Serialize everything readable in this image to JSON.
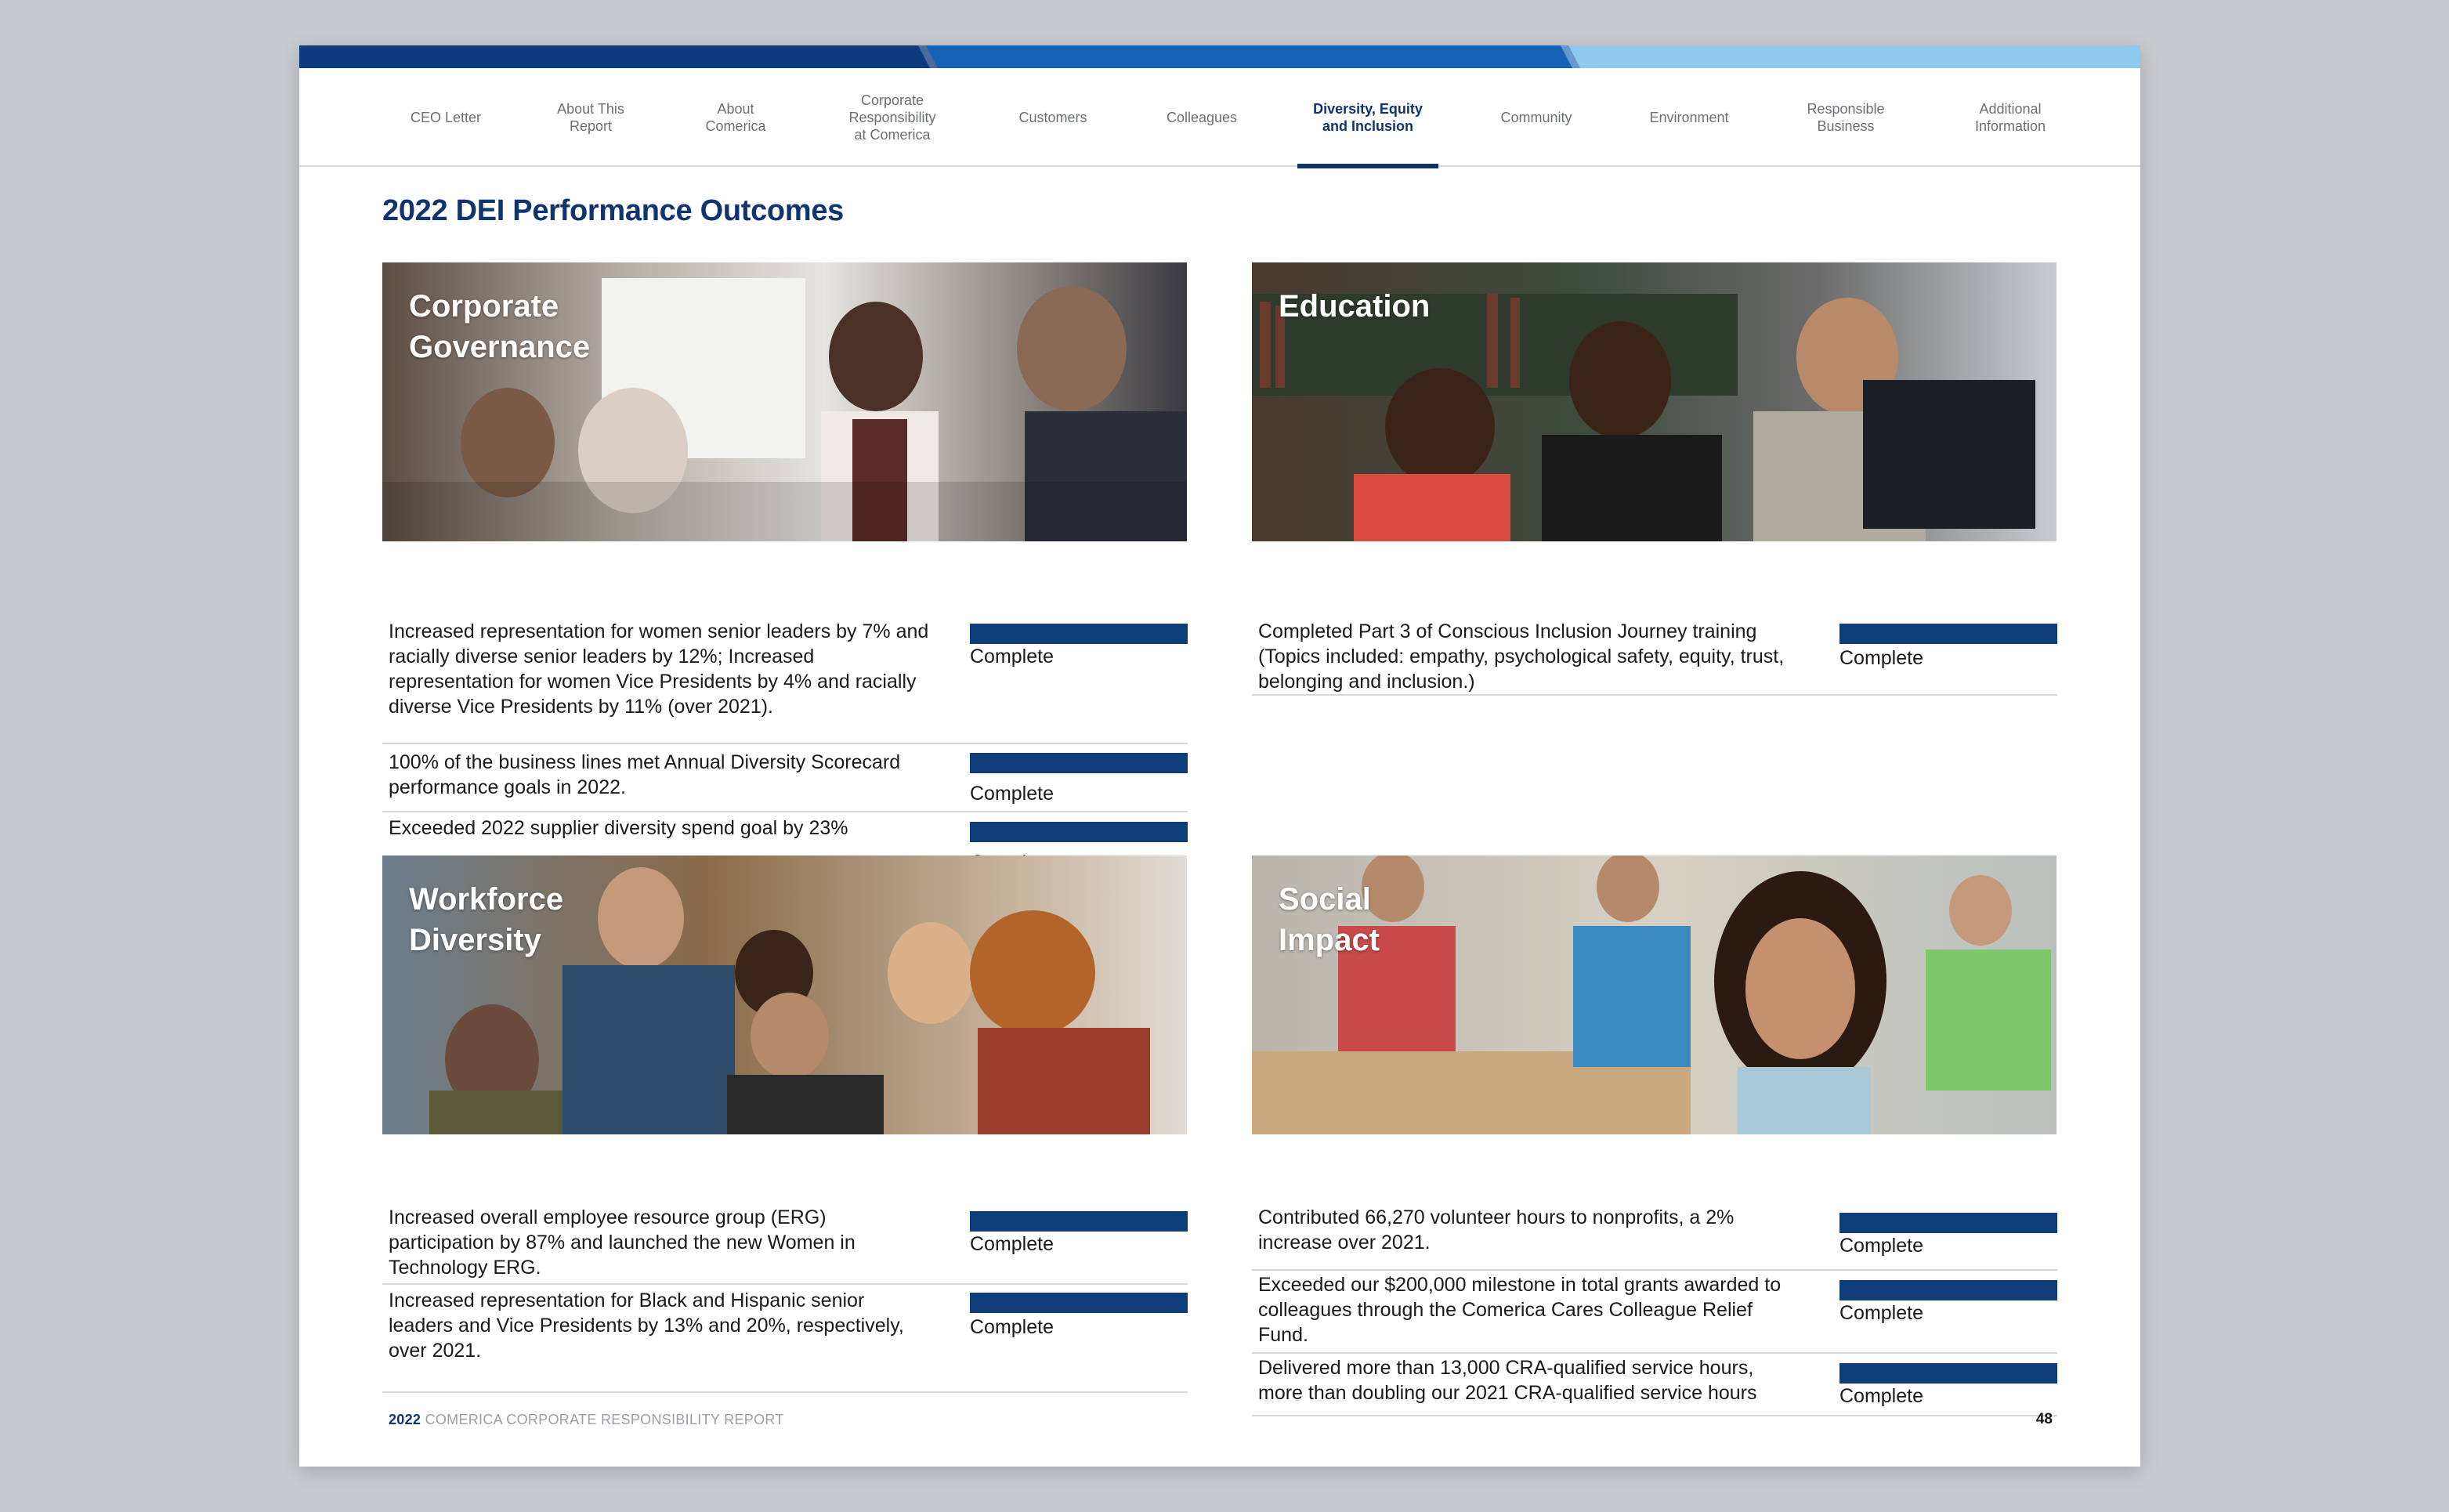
{
  "nav": {
    "items": [
      {
        "label": "CEO Letter"
      },
      {
        "label": "About This\nReport"
      },
      {
        "label": "About\nComerica"
      },
      {
        "label": "Corporate\nResponsibility\nat Comerica"
      },
      {
        "label": "Customers"
      },
      {
        "label": "Colleagues"
      },
      {
        "label": "Diversity, Equity\nand Inclusion"
      },
      {
        "label": "Community"
      },
      {
        "label": "Environment"
      },
      {
        "label": "Responsible\nBusiness"
      },
      {
        "label": "Additional\nInformation"
      }
    ],
    "active": "Diversity, Equity\nand Inclusion"
  },
  "page_title": "2022 DEI Performance Outcomes",
  "sections": {
    "corporate_governance": {
      "title": "Corporate\nGovernance",
      "rows": [
        {
          "text": "Increased representation for women senior leaders by 7% and racially diverse senior leaders by 12%; Increased representation for women Vice Presidents by 4% and racially diverse Vice Presidents by 11% (over 2021).",
          "status": "Complete"
        },
        {
          "text": "100% of the business lines met Annual Diversity Scorecard performance goals in 2022.",
          "status": "Complete"
        },
        {
          "text": "Exceeded 2022 supplier diversity spend goal by 23%",
          "status": "Complete"
        }
      ]
    },
    "education": {
      "title": "Education",
      "rows": [
        {
          "text": "Completed Part 3 of Conscious Inclusion Journey training (Topics included: empathy, psychological safety, equity, trust, belonging and inclusion.)",
          "status": "Complete"
        }
      ]
    },
    "workforce_diversity": {
      "title": "Workforce\nDiversity",
      "rows": [
        {
          "text": "Increased overall employee resource group (ERG) participation by 87% and launched the new Women in Technology ERG.",
          "status": "Complete"
        },
        {
          "text": "Increased representation for Black and Hispanic senior leaders and Vice Presidents by 13% and 20%, respectively, over 2021.",
          "status": "Complete"
        }
      ]
    },
    "social_impact": {
      "title": "Social\nImpact",
      "rows": [
        {
          "text": "Contributed 66,270 volunteer hours to nonprofits, a 2% increase over 2021.",
          "status": "Complete"
        },
        {
          "text": "Exceeded our $200,000 milestone in total grants awarded to colleagues through the Comerica Cares Colleague Relief Fund.",
          "status": "Complete"
        },
        {
          "text": "Delivered more than 13,000 CRA-qualified service hours, more than doubling our 2021 CRA-qualified service hours",
          "status": "Complete"
        }
      ]
    }
  },
  "footer": {
    "year": "2022",
    "report_name": "COMERICA CORPORATE RESPONSIBILITY REPORT",
    "page_number": "48"
  },
  "colors": {
    "brand_navy": "#0f3471",
    "bar_blue": "#0f3d7a",
    "top_stripe_dark": "#0c3a7c",
    "top_stripe_mid": "#1561b6",
    "top_stripe_light": "#8ec9ef"
  },
  "images": [
    {
      "name": "corporate-governance-photo-image",
      "subject": "business meeting photo"
    },
    {
      "name": "education-photo-image",
      "subject": "students at computer photo"
    },
    {
      "name": "workforce-diversity-photo-image",
      "subject": "team around laptop photo"
    },
    {
      "name": "social-impact-photo-image",
      "subject": "volunteer smiling photo"
    }
  ]
}
